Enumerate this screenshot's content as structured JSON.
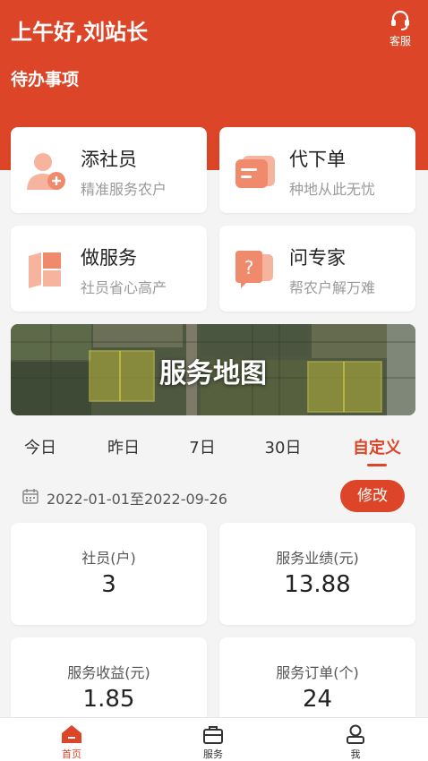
{
  "header": {
    "greeting": "上午好,刘站长",
    "service_label": "客服",
    "todo_title": "待办事项"
  },
  "quick_actions": [
    {
      "title": "添社员",
      "subtitle": "精准服务农户",
      "icon": "add-member-icon"
    },
    {
      "title": "代下单",
      "subtitle": "种地从此无忧",
      "icon": "order-icon"
    },
    {
      "title": "做服务",
      "subtitle": "社员省心高产",
      "icon": "field-map-icon"
    },
    {
      "title": "问专家",
      "subtitle": "帮农户解万难",
      "icon": "question-chat-icon"
    }
  ],
  "map_banner": {
    "title": "服务地图"
  },
  "time_tabs": {
    "items": [
      "今日",
      "昨日",
      "7日",
      "30日",
      "自定义"
    ],
    "active": "自定义"
  },
  "date_range": {
    "text": "2022-01-01至2022-09-26",
    "edit_label": "修改"
  },
  "stats": [
    {
      "label": "社员(户)",
      "value": "3"
    },
    {
      "label": "服务业绩(元)",
      "value": "13.88"
    },
    {
      "label": "服务收益(元)",
      "value": "1.85"
    },
    {
      "label": "服务订单(个)",
      "value": "24"
    }
  ],
  "bottom_nav": {
    "items": [
      {
        "label": "首页",
        "icon": "home-icon"
      },
      {
        "label": "服务",
        "icon": "briefcase-icon"
      },
      {
        "label": "我",
        "icon": "user-icon"
      }
    ],
    "active": "首页"
  },
  "colors": {
    "brand": "#dc4527",
    "icon_light": "#f6b49f",
    "icon_mid": "#ef8a6c"
  }
}
